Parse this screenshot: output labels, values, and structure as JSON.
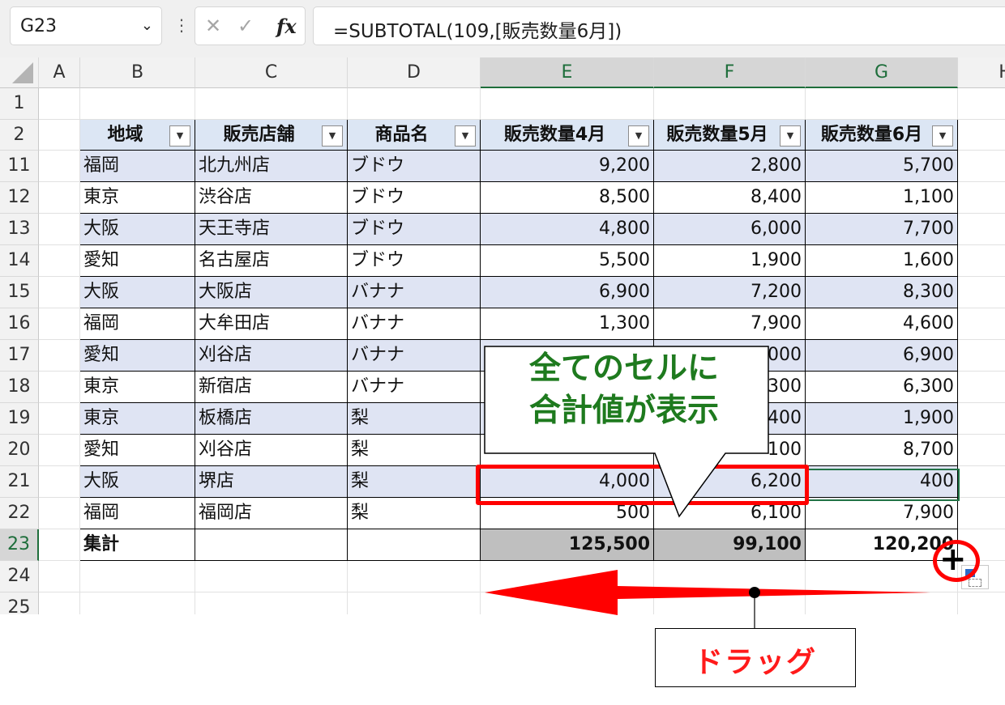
{
  "formula_bar": {
    "name_box": "G23",
    "cancel_icon": "✕",
    "enter_icon": "✓",
    "fx_label": "fx",
    "formula": "=SUBTOTAL(109,[販売数量6月])"
  },
  "columns": [
    "A",
    "B",
    "C",
    "D",
    "E",
    "F",
    "G",
    "H"
  ],
  "row_numbers": [
    "1",
    "2",
    "11",
    "12",
    "13",
    "14",
    "15",
    "16",
    "17",
    "18",
    "19",
    "20",
    "21",
    "22",
    "23",
    "24",
    "25"
  ],
  "table": {
    "headers": [
      "地域",
      "販売店舗",
      "商品名",
      "販売数量4月",
      "販売数量5月",
      "販売数量6月"
    ],
    "rows": [
      [
        "福岡",
        "北九州店",
        "ブドウ",
        "9,200",
        "2,800",
        "5,700"
      ],
      [
        "東京",
        "渋谷店",
        "ブドウ",
        "8,500",
        "8,400",
        "1,100"
      ],
      [
        "大阪",
        "天王寺店",
        "ブドウ",
        "4,800",
        "6,000",
        "7,700"
      ],
      [
        "愛知",
        "名古屋店",
        "ブドウ",
        "5,500",
        "1,900",
        "1,600"
      ],
      [
        "大阪",
        "大阪店",
        "バナナ",
        "6,900",
        "7,200",
        "8,300"
      ],
      [
        "福岡",
        "大牟田店",
        "バナナ",
        "1,300",
        "7,900",
        "4,600"
      ],
      [
        "愛知",
        "刈谷店",
        "バナナ",
        "",
        "000",
        "6,900"
      ],
      [
        "東京",
        "新宿店",
        "バナナ",
        "",
        "300",
        "6,300"
      ],
      [
        "東京",
        "板橋店",
        "梨",
        "",
        "400",
        "1,900"
      ],
      [
        "愛知",
        "刈谷店",
        "梨",
        "",
        "100",
        "8,700"
      ],
      [
        "大阪",
        "堺店",
        "梨",
        "4,000",
        "6,200",
        "400"
      ],
      [
        "福岡",
        "福岡店",
        "梨",
        "500",
        "6,100",
        "7,900"
      ]
    ],
    "total_row": [
      "集計",
      "",
      "",
      "125,500",
      "99,100",
      "120,200"
    ]
  },
  "annotations": {
    "callout_line1": "全てのセルに",
    "callout_line2": "合計値が表示",
    "drag_label": "ドラッグ",
    "highlight_color": "#ff0000",
    "callout_text_color": "#1e7a1e"
  },
  "colors": {
    "header_fill": "#dce6f4",
    "band_fill": "#dfe4f3",
    "selection": "#217346"
  }
}
